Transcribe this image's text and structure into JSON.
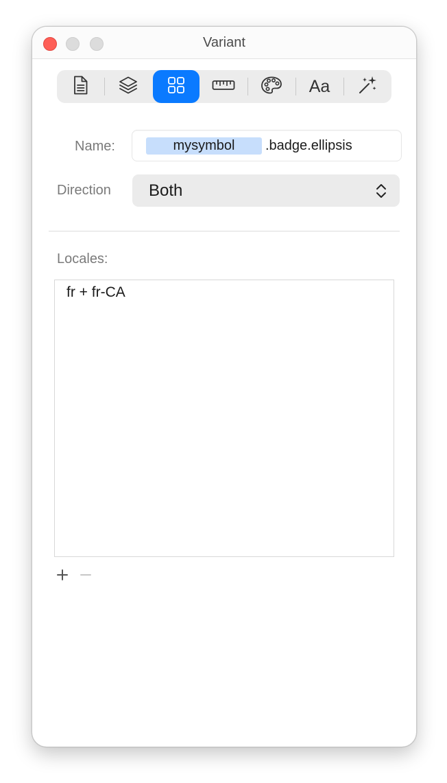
{
  "window": {
    "title": "Variant"
  },
  "toolbar": {
    "tabs": [
      {
        "icon": "document-icon",
        "active": false
      },
      {
        "icon": "layers-icon",
        "active": false
      },
      {
        "icon": "grid-icon",
        "active": true
      },
      {
        "icon": "ruler-icon",
        "active": false
      },
      {
        "icon": "palette-icon",
        "active": false
      },
      {
        "icon": "typography-icon",
        "label": "Aa",
        "active": false
      },
      {
        "icon": "magic-wand-icon",
        "active": false
      }
    ]
  },
  "form": {
    "name_label": "Name:",
    "name_token": "mysymbol",
    "name_suffix": ".badge.ellipsis",
    "direction_label": "Direction",
    "direction_value": "Both"
  },
  "locales": {
    "label": "Locales:",
    "items": [
      "fr + fr-CA"
    ],
    "add_label": "+",
    "remove_label": "−"
  },
  "colors": {
    "accent": "#0a7aff",
    "close": "#fe5f57",
    "token_highlight": "#c7defc"
  }
}
